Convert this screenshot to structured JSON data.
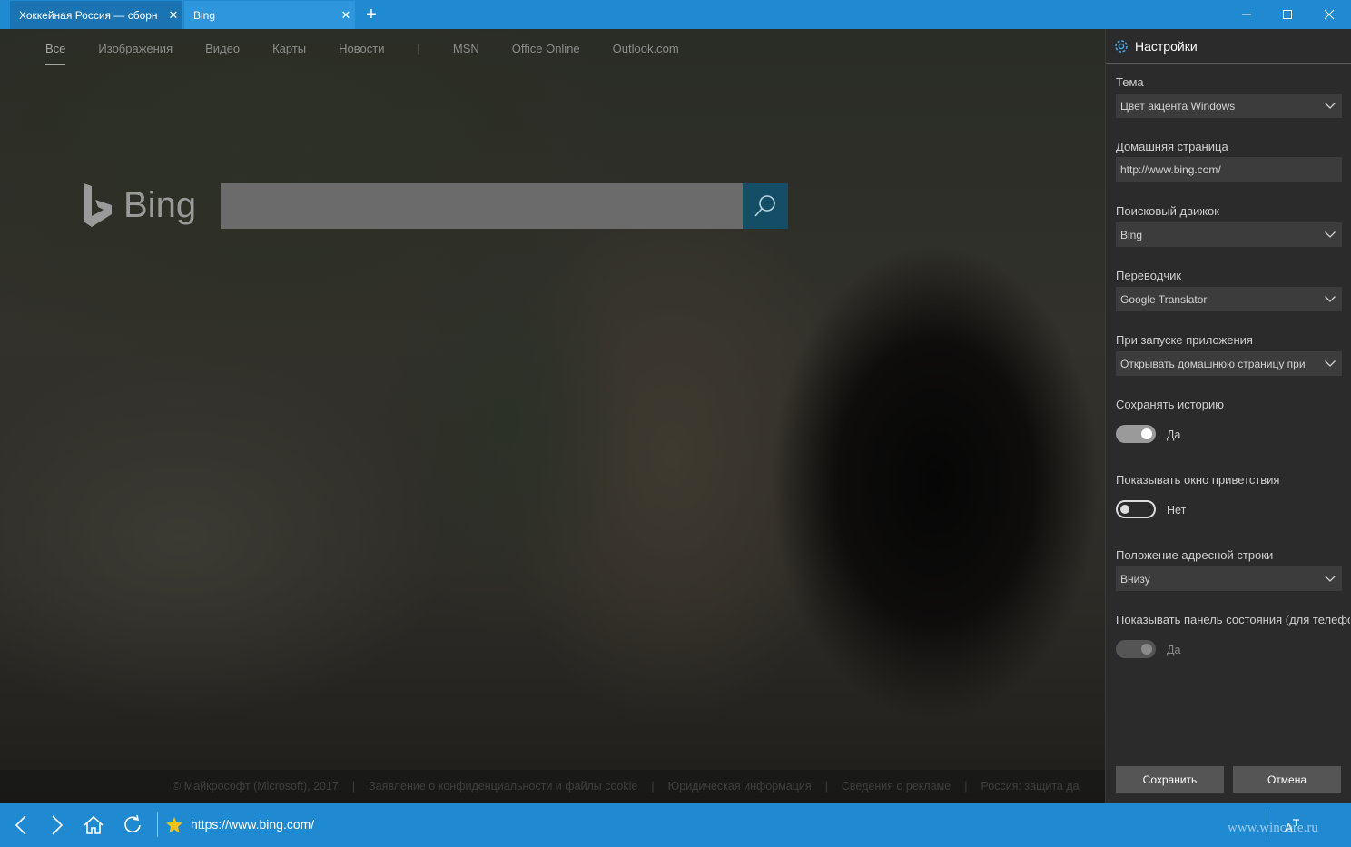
{
  "tabs": [
    {
      "label": "Хоккейная Россия — сборн",
      "close": "✕"
    },
    {
      "label": "Bing",
      "close": "✕"
    }
  ],
  "new_tab": "+",
  "bing": {
    "nav": [
      "Все",
      "Изображения",
      "Видео",
      "Карты",
      "Новости",
      "|",
      "MSN",
      "Office Online",
      "Outlook.com"
    ],
    "logo": "Bing",
    "footer": [
      "© Майкрософт (Microsoft), 2017",
      "Заявление о конфиденциальности и файлы cookie",
      "Юридическая информация",
      "Сведения о рекламе",
      "Россия: защита да"
    ],
    "footer_sep": "|"
  },
  "settings": {
    "title": "Настройки",
    "theme_label": "Тема",
    "theme_value": "Цвет акцента Windows",
    "home_label": "Домашняя страница",
    "home_value": "http://www.bing.com/",
    "search_label": "Поисковый движок",
    "search_value": "Bing",
    "translator_label": "Переводчик",
    "translator_value": "Google Translator",
    "startup_label": "При запуске приложения",
    "startup_value": "Открывать домашнюю страницу при",
    "history_label": "Сохранять историю",
    "history_state": "Да",
    "welcome_label": "Показывать окно приветствия",
    "welcome_state": "Нет",
    "address_label": "Положение адресной строки",
    "address_value": "Внизу",
    "statusbar_label": "Показывать панель состояния (для телефо",
    "statusbar_state": "Да",
    "save": "Сохранить",
    "cancel": "Отмена"
  },
  "toolbar": {
    "url": "https://www.bing.com/",
    "watermark": "www.wincore.ru"
  },
  "colors": {
    "accent": "#1f8ad2",
    "panel": "#2b2b2b",
    "search_button": "#134d66"
  }
}
